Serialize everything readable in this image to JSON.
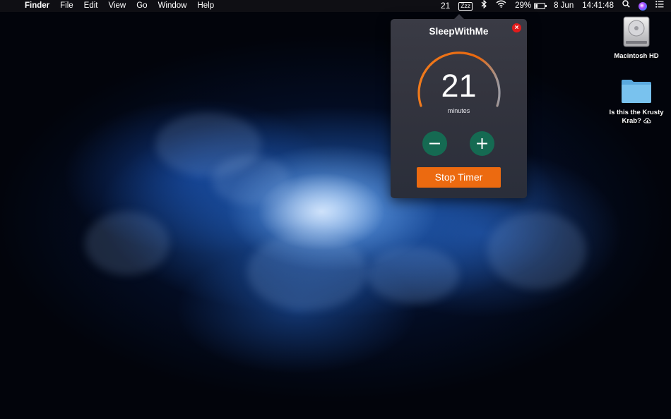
{
  "menubar": {
    "apple_glyph": "",
    "app_name": "Finder",
    "menus": [
      "File",
      "Edit",
      "View",
      "Go",
      "Window",
      "Help"
    ],
    "timer_readout": "21",
    "sleep_icon_label": "Zzz",
    "battery_percent": "29%",
    "battery_level": 0.29,
    "date": "8 Jun",
    "time": "14:41:48"
  },
  "popover": {
    "title": "SleepWithMe",
    "close_glyph": "×",
    "dial_value": "21",
    "dial_unit": "minutes",
    "stop_label": "Stop Timer",
    "accent": "#ec6a10",
    "button_color": "#156a52"
  },
  "desktop": {
    "items": [
      {
        "label": "Macintosh HD",
        "icon": "hard-drive-icon"
      },
      {
        "label_line1": "Is this the Krusty",
        "label_line2": "Krab?",
        "icon": "folder-icon",
        "badge": "icloud-download-icon"
      }
    ]
  }
}
